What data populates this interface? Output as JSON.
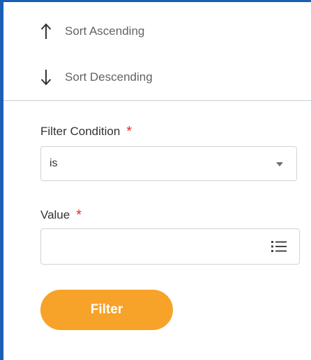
{
  "sort": {
    "ascending_label": "Sort Ascending",
    "descending_label": "Sort Descending"
  },
  "filter_condition": {
    "label": "Filter Condition",
    "required_mark": "*",
    "selected": "is"
  },
  "value": {
    "label": "Value",
    "required_mark": "*",
    "input_value": "",
    "placeholder": ""
  },
  "filter_button": {
    "label": "Filter"
  },
  "colors": {
    "accent_border": "#1a5fb4",
    "button": "#f7a228",
    "required": "#d93025"
  },
  "icons": {
    "sort_ascending": "arrow-up-icon",
    "sort_descending": "arrow-down-icon",
    "dropdown": "caret-down-icon",
    "prompt": "list-icon"
  }
}
